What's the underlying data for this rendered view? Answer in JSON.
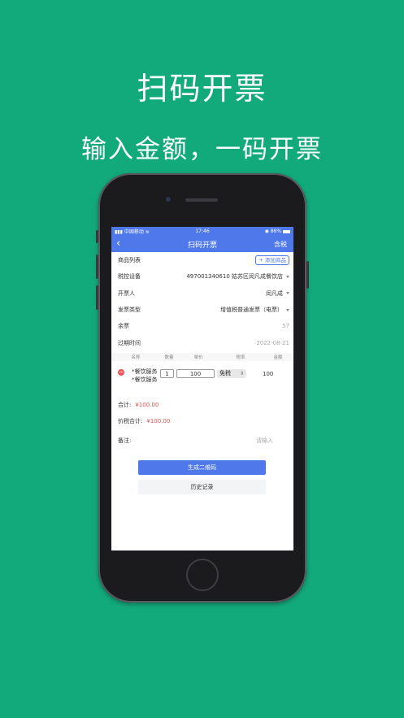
{
  "promo": {
    "title": "扫码开票",
    "subtitle": "输入金额，一码开票"
  },
  "statusbar": {
    "carrier": "中国移动",
    "time": "17:46",
    "battery": "86%"
  },
  "navbar": {
    "title": "扫码开票",
    "right_action": "含税"
  },
  "form": {
    "goods_list_label": "商品列表",
    "add_goods_label": "+ 添加商品",
    "device_label": "税控设备",
    "device_value": "497001340610 姑苏区闵凡成餐饮店",
    "issuer_label": "开票人",
    "issuer_value": "闵凡成",
    "invoice_type_label": "发票类型",
    "invoice_type_value": "增值税普通发票（电票）",
    "remaining_label": "余票",
    "remaining_value": "57",
    "expiry_label": "过期时间",
    "expiry_value": "2022-08-21"
  },
  "table": {
    "headers": [
      "名称",
      "数量",
      "单价",
      "税率",
      "金额"
    ],
    "rows": [
      {
        "name": "*餐饮服务*餐饮服务",
        "quantity": "1",
        "unit_price": "100",
        "tax_rate": "免税",
        "amount": "100"
      }
    ]
  },
  "totals": {
    "total_label": "合计:",
    "total_value": "¥100.00",
    "total_with_tax_label": "价税合计:",
    "total_with_tax_value": "¥100.00"
  },
  "remark": {
    "label": "备注:",
    "placeholder": "请输入"
  },
  "buttons": {
    "generate_qr": "生成二维码",
    "history": "历史记录"
  },
  "colors": {
    "background": "#13aa7b",
    "primary": "#4f79ea",
    "price": "#d9534f"
  }
}
